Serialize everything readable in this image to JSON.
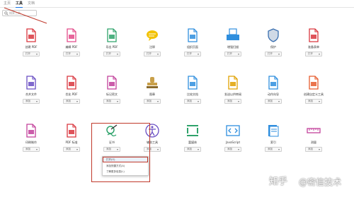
{
  "nav": {
    "tabs": [
      {
        "label": "主页"
      },
      {
        "label": "工具"
      },
      {
        "label": "文档"
      }
    ]
  },
  "search": {
    "placeholder": "搜索工具"
  },
  "tools": [
    {
      "label": "创建 PDF",
      "button": "打开",
      "color": "#d9363e",
      "icon": "create-pdf-icon"
    },
    {
      "label": "编辑 PDF",
      "button": "打开",
      "color": "#e34b8a",
      "icon": "edit-pdf-icon"
    },
    {
      "label": "导出 PDF",
      "button": "打开",
      "color": "#2fa36b",
      "icon": "export-pdf-icon"
    },
    {
      "label": "注释",
      "button": "打开",
      "color": "#f2c200",
      "icon": "comment-icon"
    },
    {
      "label": "组织页面",
      "button": "打开",
      "color": "#2e8ede",
      "icon": "organize-pages-icon"
    },
    {
      "label": "增强扫描",
      "button": "打开",
      "color": "#2e8ede",
      "icon": "scan-icon"
    },
    {
      "label": "保护",
      "button": "打开",
      "color": "#3a6fb0",
      "icon": "protect-icon"
    },
    {
      "label": "准备表单",
      "button": "打开",
      "color": "#d9363e",
      "icon": "prepare-form-icon"
    },
    {
      "label": "合并文件",
      "button": "添加",
      "color": "#6a4fc4",
      "icon": "combine-files-icon"
    },
    {
      "label": "优化 PDF",
      "button": "添加",
      "color": "#d9363e",
      "icon": "optimize-pdf-icon"
    },
    {
      "label": "标记密文",
      "button": "添加",
      "color": "#c2419b",
      "icon": "redact-icon"
    },
    {
      "label": "图章",
      "button": "添加",
      "color": "#c9a04a",
      "icon": "stamp-icon"
    },
    {
      "label": "比较文档",
      "button": "添加",
      "color": "#2e8ede",
      "icon": "compare-icon"
    },
    {
      "label": "发送以供审阅",
      "button": "添加",
      "color": "#e0a100",
      "icon": "send-review-icon"
    },
    {
      "label": "动作向导",
      "button": "添加",
      "color": "#2e8ede",
      "icon": "action-wizard-icon"
    },
    {
      "label": "创建自定义工具",
      "button": "添加",
      "color": "#e65c2e",
      "icon": "custom-tool-icon"
    },
    {
      "label": "印刷制作",
      "button": "添加",
      "color": "#c2419b",
      "icon": "print-production-icon"
    },
    {
      "label": "PDF 标准",
      "button": "添加",
      "color": "#d9363e",
      "icon": "pdf-standards-icon"
    },
    {
      "label": "证书",
      "button": "添加",
      "color": "#2fa36b",
      "icon": "certificate-icon"
    },
    {
      "label": "辅助工具",
      "button": "添加",
      "color": "#6a4fc4",
      "icon": "accessibility-icon"
    },
    {
      "label": "富媒体",
      "button": "添加",
      "color": "#2fa36b",
      "icon": "rich-media-icon"
    },
    {
      "label": "JavaScript",
      "button": "添加",
      "color": "#2e8ede",
      "icon": "javascript-icon"
    },
    {
      "label": "索引",
      "button": "添加",
      "color": "#2e8ede",
      "icon": "index-icon"
    },
    {
      "label": "测量",
      "button": "添加",
      "color": "#c2419b",
      "icon": "measure-icon"
    }
  ],
  "context_menu": {
    "items": [
      {
        "label": "打开(O)"
      },
      {
        "label": "添加快捷方式(A)"
      },
      {
        "label": "了解更多信息(L)"
      }
    ]
  },
  "watermark": {
    "logo": "知乎",
    "text": "@密信技术"
  },
  "accent_color": "#1473e6",
  "annotation_color": "#c0392b"
}
